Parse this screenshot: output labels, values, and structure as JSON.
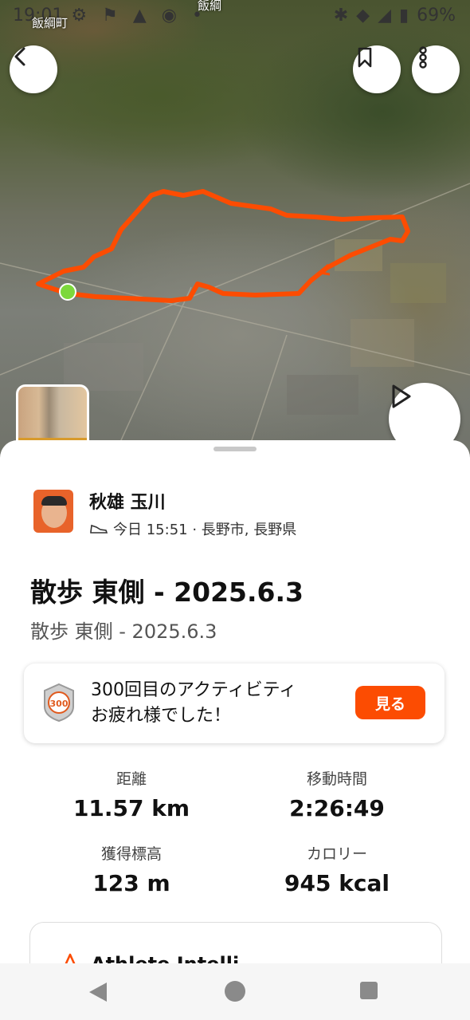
{
  "status_bar": {
    "time": "19:01",
    "battery": "69%"
  },
  "map": {
    "place_label_1": "飯綱町",
    "place_label_2": "飯綱",
    "route_color": "#fc4c02",
    "start_color": "#7cd83c"
  },
  "header_buttons": {
    "back": "back-icon",
    "bookmark": "bookmark-icon",
    "more": "more-icon",
    "play": "play-icon"
  },
  "activity": {
    "athlete_name": "秋雄 玉川",
    "meta": "今日 15:51 · 長野市, 長野県",
    "title": "散歩 東側 - 2025.6.3",
    "description": "散歩 東側 - 2025.6.3"
  },
  "milestone": {
    "badge_number": "300",
    "line1": "300回目のアクティビティ",
    "line2": "お疲れ様でした！",
    "button": "見る"
  },
  "stats": [
    {
      "label": "距離",
      "value": "11.57 km"
    },
    {
      "label": "移動時間",
      "value": "2:26:49"
    },
    {
      "label": "獲得標高",
      "value": "123 m"
    },
    {
      "label": "カロリー",
      "value": "945 kcal"
    }
  ],
  "athlete_intelligence": {
    "label": "Athlete Intelli"
  },
  "accent_color": "#fc4c02"
}
